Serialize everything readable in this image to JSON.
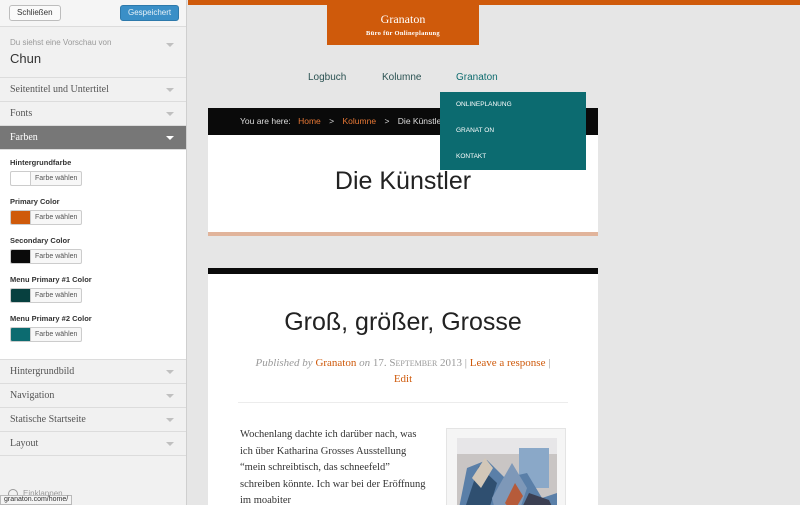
{
  "sidebar": {
    "close_label": "Schließen",
    "saved_label": "Gespeichert",
    "preview_text": "Du siehst eine Vorschau von",
    "theme_name": "Chun",
    "sections_top": [
      "Seitentitel und Untertitel",
      "Fonts",
      "Farben"
    ],
    "colors": [
      {
        "label": "Hintergrundfarbe",
        "swatch": "#ffffff",
        "button": "Farbe wählen"
      },
      {
        "label": "Primary Color",
        "swatch": "#cf5a0b",
        "button": "Farbe wählen"
      },
      {
        "label": "Secondary Color",
        "swatch": "#0a0a0a",
        "button": "Farbe wählen"
      },
      {
        "label": "Menu Primary #1 Color",
        "swatch": "#07403f",
        "button": "Farbe wählen"
      },
      {
        "label": "Menu Primary #2 Color",
        "swatch": "#0c6b70",
        "button": "Farbe wählen"
      }
    ],
    "sections_bottom": [
      "Hintergrundbild",
      "Navigation",
      "Statische Startseite",
      "Layout"
    ],
    "collapse_label": "Einklappen",
    "status_url": "granaton.com/home/"
  },
  "site": {
    "title": "Granaton",
    "tagline": "Büro für Onlineplanung",
    "nav": [
      "Logbuch",
      "Kolumne",
      "Granaton"
    ],
    "dropdown": [
      "ONLINEPLANUNG",
      "GRANAT ON",
      "KONTAKT"
    ],
    "breadcrumb": {
      "prefix": "You are here:",
      "items": [
        "Home",
        "Kolumne",
        "Die Künstler"
      ]
    },
    "page_title": "Die Künstler",
    "post": {
      "title": "Groß, größer, Grosse",
      "published_by": "Published by",
      "author": "Granaton",
      "on": "on",
      "date": "17. September 2013",
      "separator": "|",
      "respond": "Leave a response",
      "edit": "Edit",
      "body": "Wochenlang dachte ich darüber nach, was ich über Katharina Grosses Ausstellung “mein schreibtisch, das schneefeld” schreiben könnte. Ich war bei der Eröffnung im moabiter"
    }
  },
  "colors": {
    "primary": "#cf5a0b",
    "secondary": "#0a0a0a",
    "menu1": "#07403f",
    "menu2": "#0c6b70",
    "admin_blue": "#3a8fc7"
  }
}
